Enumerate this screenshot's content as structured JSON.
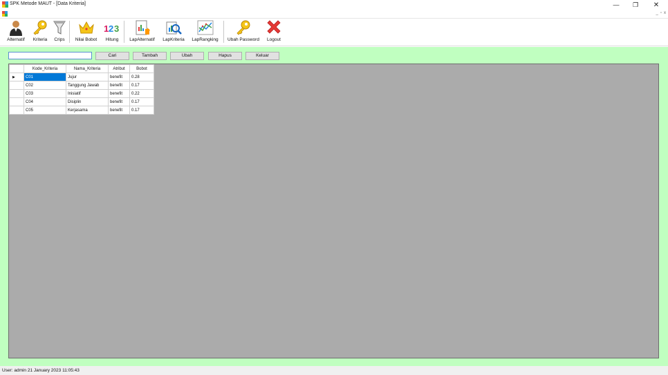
{
  "window": {
    "title": "SPK Metode MAUT - [Data Kriteria]",
    "minimize_glyph": "—",
    "restore_glyph": "❐",
    "close_glyph": "✕"
  },
  "mdi": {
    "buttons": [
      "_",
      "▫",
      "x"
    ]
  },
  "toolbar": {
    "items": [
      {
        "label": "Alternatif",
        "icon": "user-icon"
      },
      {
        "label": "Kriteria",
        "icon": "key-icon"
      },
      {
        "label": "Crips",
        "icon": "filter-icon"
      },
      {
        "label": "Nilai Bobot",
        "icon": "crown-icon"
      },
      {
        "label": "Hitung",
        "icon": "numbers-icon",
        "icon_text": "123"
      },
      {
        "label": "LapAlternatif",
        "icon": "report-icon"
      },
      {
        "label": "LapKriteria",
        "icon": "magnifier-icon"
      },
      {
        "label": "LapRangking",
        "icon": "chart-icon"
      },
      {
        "label": "Ubah Password",
        "icon": "key-icon"
      },
      {
        "label": "Logout",
        "icon": "x-icon"
      }
    ]
  },
  "search": {
    "value": "",
    "placeholder": ""
  },
  "buttons": {
    "cari": "Cari",
    "tambah": "Tambah",
    "ubah": "Ubah",
    "hapus": "Hapus",
    "keluar": "Keluar"
  },
  "grid": {
    "columns": [
      "Kode_Kriteria",
      "Nama_Kriteria",
      "Atribut",
      "Bobot"
    ],
    "current_row_marker": "▶",
    "rows": [
      [
        "C01",
        "Jujur",
        "benefit",
        "0.28"
      ],
      [
        "C02",
        "Tanggung Jawab",
        "benefit",
        "0.17"
      ],
      [
        "C03",
        "Inisiatif",
        "benefit",
        "0.22"
      ],
      [
        "C04",
        "Disiplin",
        "benefit",
        "0.17"
      ],
      [
        "C05",
        "Kerjasama",
        "benefit",
        "0.17"
      ]
    ]
  },
  "status": {
    "text": "User: admin  21 January 2023 11:05:43"
  },
  "colors": {
    "main_bg": "#c0ffc0",
    "grid_bg": "#ababab",
    "selection": "#0078d7"
  }
}
